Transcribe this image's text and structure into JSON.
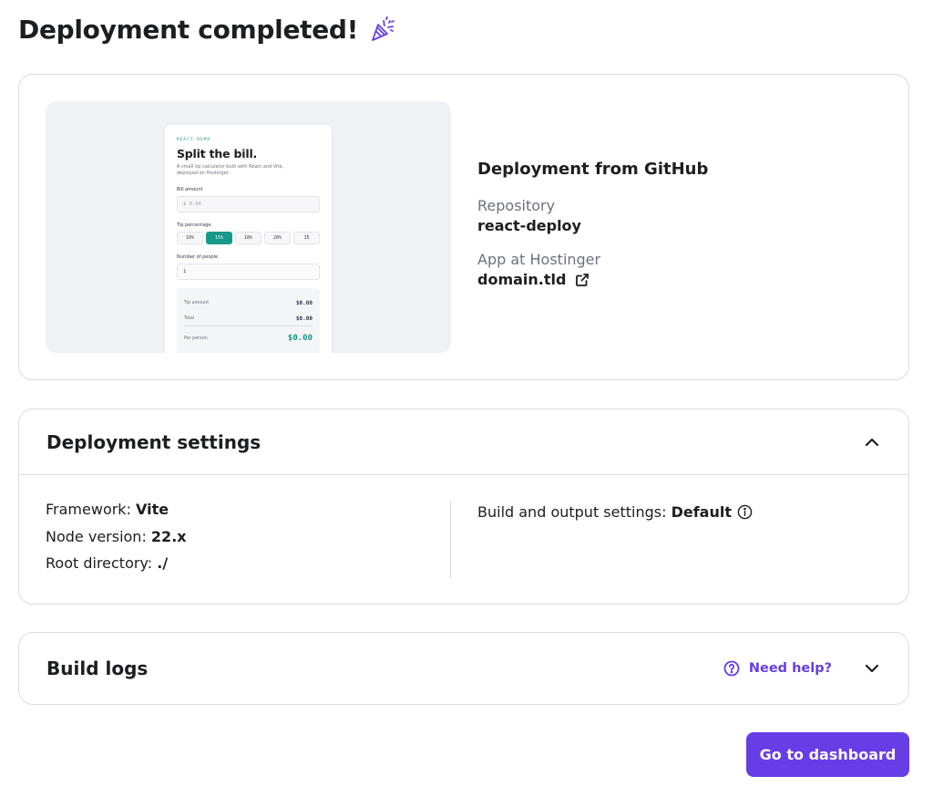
{
  "header": {
    "title": "Deployment completed!",
    "icon": "party-popper-icon"
  },
  "preview": {
    "eyebrow": "REACT DEMO",
    "heading": "Split the bill.",
    "subtitle": "A small tip calculator built with React and Vite, deployed on Hostinger.",
    "bill_label": "Bill amount",
    "bill_placeholder": "$ 0.00",
    "tip_label": "Tip percentage",
    "tips": [
      "10%",
      "15%",
      "18%",
      "20%",
      "15"
    ],
    "active_tip": "15%",
    "people_label": "Number of people",
    "people_value": "1",
    "tip_amount_label": "Tip amount",
    "tip_amount_value": "$0.00",
    "total_label": "Total",
    "total_value": "$0.00",
    "per_person_label": "Per person",
    "per_person_value": "$0.00",
    "accent_color": "#17988a"
  },
  "deployment": {
    "heading": "Deployment from GitHub",
    "repository_label": "Repository",
    "repository_value": "react-deploy",
    "app_label": "App at Hostinger",
    "app_value": "domain.tld",
    "app_icon": "external-link-icon"
  },
  "settings": {
    "heading": "Deployment settings",
    "expanded": true,
    "framework_label": "Framework: ",
    "framework_value": "Vite",
    "node_label": "Node version: ",
    "node_value": "22.x",
    "root_label": "Root directory: ",
    "root_value": "./",
    "build_label": "Build and output settings: ",
    "build_value": "Default",
    "build_icon": "info-icon"
  },
  "logs": {
    "heading": "Build logs",
    "help_label": "Need help?",
    "expanded": false
  },
  "actions": {
    "primary_label": "Go to dashboard",
    "primary_color": "#673de6"
  }
}
